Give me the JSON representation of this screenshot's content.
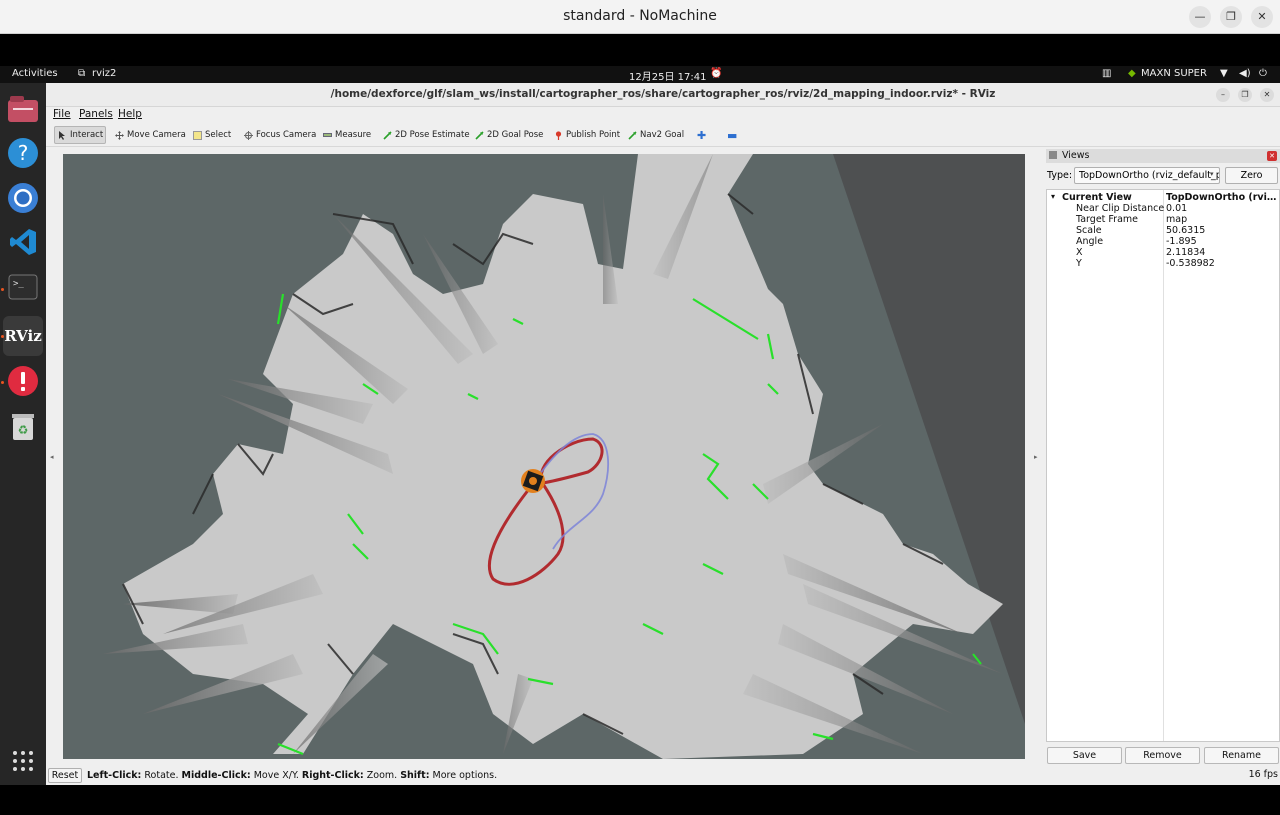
{
  "nomachine": {
    "title": "standard - NoMachine"
  },
  "gnome": {
    "activities": "Activities",
    "app_name": "rviz2",
    "clock": "12月25日  17:41",
    "power_mode": "MAXN SUPER"
  },
  "dock": {
    "items": [
      "files-icon",
      "help-icon",
      "chromium-icon",
      "vscode-icon",
      "terminal-icon",
      "rviz-icon",
      "software-updater-icon",
      "trash-icon"
    ],
    "apps_grid": "show-applications-icon",
    "rviz_label": "RViz"
  },
  "rviz": {
    "title": "/home/dexforce/glf/slam_ws/install/cartographer_ros/share/cartographer_ros/rviz/2d_mapping_indoor.rviz* - RViz",
    "menu": [
      "File",
      "Panels",
      "Help"
    ],
    "tools": [
      {
        "label": "Interact",
        "icon": "cursor-icon"
      },
      {
        "label": "Move Camera",
        "icon": "move-icon"
      },
      {
        "label": "Select",
        "icon": "select-icon"
      },
      {
        "label": "Focus Camera",
        "icon": "focus-icon"
      },
      {
        "label": "Measure",
        "icon": "ruler-icon"
      },
      {
        "label": "2D Pose Estimate",
        "icon": "pose-estimate-icon"
      },
      {
        "label": "2D Goal Pose",
        "icon": "goal-pose-icon"
      },
      {
        "label": "Publish Point",
        "icon": "pin-icon"
      },
      {
        "label": "Nav2 Goal",
        "icon": "nav-goal-icon"
      }
    ],
    "views_panel": {
      "header": "Views",
      "type_label": "Type:",
      "type_value": "TopDownOrtho (rviz_default_plugins)",
      "zero_button": "Zero",
      "properties": [
        {
          "key": "Current View",
          "value": "TopDownOrtho (rviz_default_plugins)",
          "bold": true
        },
        {
          "key": "Near Clip Distance",
          "value": "0.01"
        },
        {
          "key": "Target Frame",
          "value": "map"
        },
        {
          "key": "Scale",
          "value": "50.6315"
        },
        {
          "key": "Angle",
          "value": "-1.895"
        },
        {
          "key": "X",
          "value": "2.11834"
        },
        {
          "key": "Y",
          "value": "-0.538982"
        }
      ],
      "buttons": {
        "save": "Save",
        "remove": "Remove",
        "rename": "Rename"
      }
    },
    "status": {
      "reset": "Reset",
      "hint_parts": [
        {
          "b": "Left-Click:",
          "t": " Rotate. "
        },
        {
          "b": "Middle-Click:",
          "t": " Move X/Y. "
        },
        {
          "b": "Right-Click:",
          "t": " Zoom. "
        },
        {
          "b": "Shift:",
          "t": " More options."
        }
      ],
      "fps": "16 fps"
    }
  }
}
